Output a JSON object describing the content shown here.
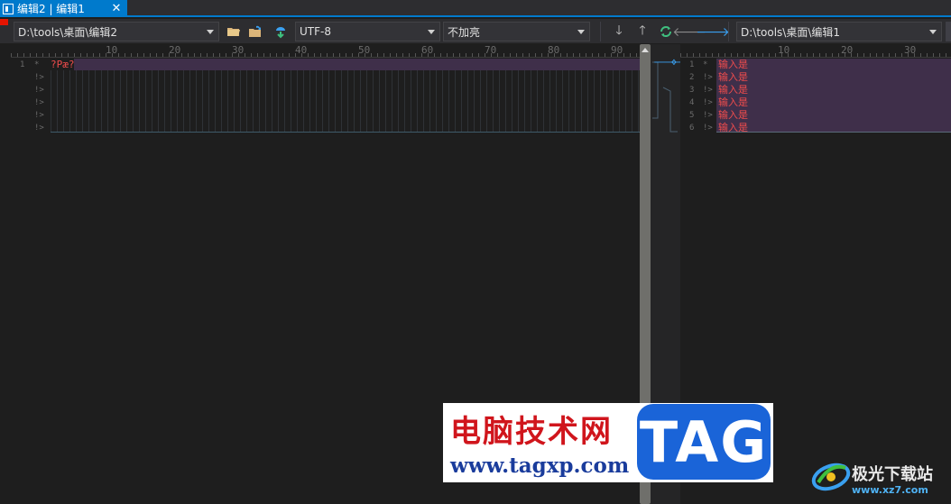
{
  "tab": {
    "title": "编辑2 | 编辑1",
    "close_icon": "close-icon"
  },
  "toolbar": {
    "left_path": "D:\\tools\\桌面\\编辑2",
    "encoding": "UTF-8",
    "highlight": "不加亮",
    "right_path": "D:\\tools\\桌面\\编辑1",
    "icons": [
      "open-folder-icon",
      "reload-folder-icon",
      "sync-icon",
      "next-diff-icon",
      "prev-diff-icon",
      "refresh-icon",
      "copy-left-icon",
      "copy-right-icon"
    ]
  },
  "left_pane": {
    "ruler_ticks": [
      "10",
      "20",
      "30",
      "40",
      "50",
      "60",
      "70",
      "80",
      "90"
    ],
    "lines": [
      {
        "num": "1",
        "mark": "*",
        "text": "?Pæ?"
      },
      {
        "num": "",
        "mark": "!>",
        "text": ""
      },
      {
        "num": "",
        "mark": "!>",
        "text": ""
      },
      {
        "num": "",
        "mark": "!>",
        "text": ""
      },
      {
        "num": "",
        "mark": "!>",
        "text": ""
      },
      {
        "num": "",
        "mark": "!>",
        "text": ""
      }
    ]
  },
  "right_pane": {
    "ruler_ticks": [
      "10",
      "20",
      "30"
    ],
    "lines": [
      {
        "num": "1",
        "mark": "*",
        "text": "输入是"
      },
      {
        "num": "2",
        "mark": "!>",
        "text": "输入是"
      },
      {
        "num": "3",
        "mark": "!>",
        "text": "输入是"
      },
      {
        "num": "4",
        "mark": "!>",
        "text": "输入是"
      },
      {
        "num": "5",
        "mark": "!>",
        "text": "输入是"
      },
      {
        "num": "6",
        "mark": "!>",
        "text": "输入是"
      }
    ]
  },
  "watermark": {
    "cn_text": "电脑技术网",
    "url": "www.tagxp.com",
    "tag": "TAG",
    "site_name": "极光下载站",
    "site_url": "www.xz7.com"
  },
  "colors": {
    "accent": "#007acc",
    "diff_bg": "#3f2f4a",
    "diff_text": "#f14c4c"
  }
}
